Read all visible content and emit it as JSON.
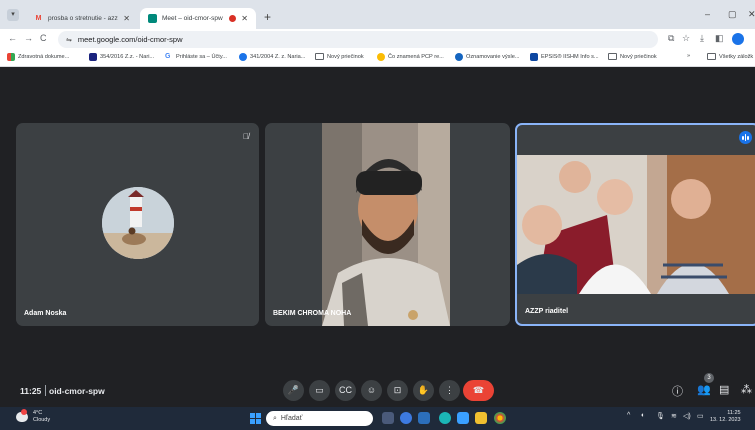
{
  "browser": {
    "tabs": [
      {
        "title": "prosba o stretnutie - azzpriadit...",
        "favicon": "gmail-icon",
        "active": false
      },
      {
        "title": "Meet – oid-cmor-spw",
        "favicon": "meet-icon",
        "active": true
      }
    ],
    "url": "meet.google.com/oid-cmor-spw",
    "window_controls": {
      "minimize": "–",
      "restore": "▢",
      "close": "✕"
    },
    "bookmarks": [
      {
        "label": "Zdravotná dokume...",
        "color": "#34a853"
      },
      {
        "label": "354/2016 Z.z. - Nari...",
        "color": "#1a237e"
      },
      {
        "label": "Prihláste sa – Účty...",
        "color": "#4285f4"
      },
      {
        "label": "341/2004 Z. z. Naria...",
        "color": "#1a73e8"
      },
      {
        "label": "Nový priečinok",
        "color": "folder"
      },
      {
        "label": "Čo znamená PCP re...",
        "color": "#fbbc04"
      },
      {
        "label": "Oznamovanie výsle...",
        "color": "#1565c0"
      },
      {
        "label": "EPSIS® IISHM Info s...",
        "color": "#0d47a1"
      },
      {
        "label": "Nový priečinok",
        "color": "folder"
      },
      {
        "label": "Všetky záložk",
        "color": "folder"
      }
    ]
  },
  "meet": {
    "participants": [
      {
        "name": "Adam Noska"
      },
      {
        "name": "BEKIM CHROMA NOHA"
      },
      {
        "name": "AZZP riaditel"
      }
    ],
    "time": "11:25",
    "meeting_code": "oid-cmor-spw",
    "people_count": "3"
  },
  "taskbar": {
    "temperature": "4°C",
    "weather": "Cloudy",
    "search_placeholder": "Hľadať",
    "time": "11:25",
    "date": "13. 12. 2023"
  }
}
